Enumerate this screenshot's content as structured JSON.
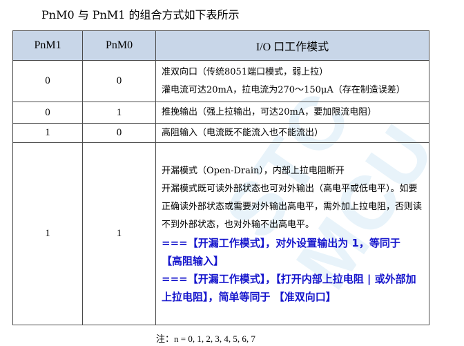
{
  "caption": "PnM0 与 PnM1 的组合方式如下表所示",
  "watermark": "STC MCU",
  "headers": [
    "PnM1",
    "PnM0",
    "I/O 口工作模式"
  ],
  "rows": [
    {
      "pnm1": "0",
      "pnm0": "0",
      "lines": [
        "准双向口（传统8051端口模式，弱上拉）",
        "灌电流可达20mA，拉电流为270～150μA（存在制造误差）"
      ]
    },
    {
      "pnm1": "0",
      "pnm0": "1",
      "lines": [
        "推挽输出（强上拉输出，可达20mA，要加限流电阻）"
      ]
    },
    {
      "pnm1": "1",
      "pnm0": "0",
      "lines": [
        "高阻输入（电流既不能流入也不能流出）"
      ]
    },
    {
      "pnm1": "1",
      "pnm0": "1",
      "lines": [
        "开漏模式（Open-Drain），内部上拉电阻断开",
        "开漏模式既可读外部状态也可对外输出（高电平或低电平）。如要正确读外部状态或需要对外输出高电平，需外加上拉电阻，否则读不到外部状态，也对外输不出高电平。"
      ],
      "notes": [
        "===【开漏工作模式】，对外设置输出为 1，等同于 【高阻输入】",
        "===【开漏工作模式】，【打开内部上拉电阻 | 或外部加上拉电阻】，简单等同于 【准双向口】"
      ]
    }
  ],
  "footnote": "注：n = 0, 1, 2, 3, 4, 5, 6, 7",
  "colors": {
    "header_bg": "#c8d6e8",
    "note_text": "#1515cc",
    "border": "#4a4a4a"
  }
}
